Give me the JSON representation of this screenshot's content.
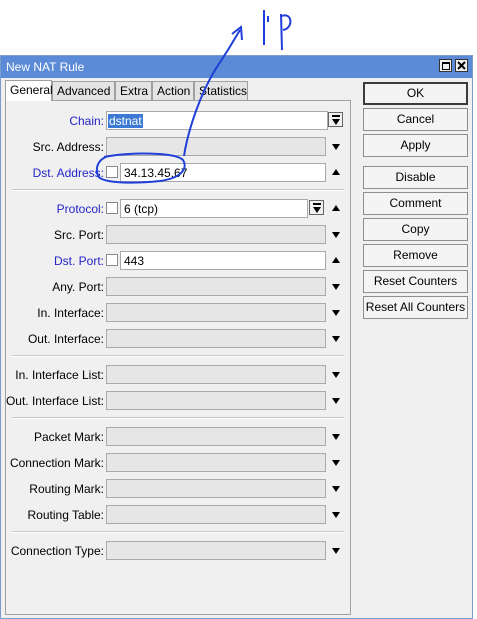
{
  "window": {
    "title": "New NAT Rule"
  },
  "tabs": [
    {
      "label": "General",
      "active": true
    },
    {
      "label": "Advanced",
      "active": false
    },
    {
      "label": "Extra",
      "active": false
    },
    {
      "label": "Action",
      "active": false
    },
    {
      "label": "Statistics",
      "active": false
    }
  ],
  "fields": {
    "chain": {
      "label": "Chain:",
      "value": "dstnat"
    },
    "src_address": {
      "label": "Src. Address:",
      "value": ""
    },
    "dst_address": {
      "label": "Dst. Address:",
      "value": "34.13.45.67"
    },
    "protocol": {
      "label": "Protocol:",
      "value": "6 (tcp)"
    },
    "src_port": {
      "label": "Src. Port:",
      "value": ""
    },
    "dst_port": {
      "label": "Dst. Port:",
      "value": "443"
    },
    "any_port": {
      "label": "Any. Port:",
      "value": ""
    },
    "in_interface": {
      "label": "In. Interface:",
      "value": ""
    },
    "out_interface": {
      "label": "Out. Interface:",
      "value": ""
    },
    "in_interface_list": {
      "label": "In. Interface List:",
      "value": ""
    },
    "out_interface_list": {
      "label": "Out. Interface List:",
      "value": ""
    },
    "packet_mark": {
      "label": "Packet Mark:",
      "value": ""
    },
    "connection_mark": {
      "label": "Connection Mark:",
      "value": ""
    },
    "routing_mark": {
      "label": "Routing Mark:",
      "value": ""
    },
    "routing_table": {
      "label": "Routing Table:",
      "value": ""
    },
    "connection_type": {
      "label": "Connection Type:",
      "value": ""
    }
  },
  "buttons": {
    "ok": "OK",
    "cancel": "Cancel",
    "apply": "Apply",
    "disable": "Disable",
    "comment": "Comment",
    "copy": "Copy",
    "remove": "Remove",
    "reset_counters": "Reset Counters",
    "reset_all_counters": "Reset All Counters"
  },
  "annotation": {
    "text": "ip",
    "color": "#1f3fd8"
  },
  "colors": {
    "title_bar": "#5b8ad6",
    "blue_label": "#2424c8",
    "selection": "#3b79d4"
  }
}
